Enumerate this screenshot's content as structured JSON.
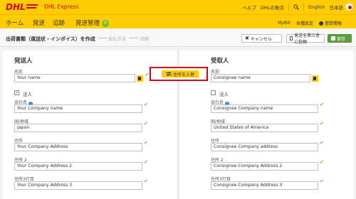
{
  "header": {
    "brand": "DHL Express",
    "links": [
      "ヘルプ",
      "DHLの拠点"
    ],
    "lang_en": "English",
    "lang_ja": "日本語"
  },
  "nav": {
    "items": [
      "ホーム",
      "発送",
      "追跡",
      "発送管理"
    ],
    "badge": "0",
    "right": [
      "MyBill",
      "各種設定"
    ],
    "user": "登録情報"
  },
  "subheader": {
    "step_active": "出荷書類（運送状・インボイス）を作成",
    "steps": [
      "支払方法",
      "印刷"
    ],
    "cancel": "キャンセル",
    "send": "発送を第三者に依頼",
    "save": "保存"
  },
  "swap": {
    "label": "住所を入替"
  },
  "sender": {
    "title": "発送人",
    "name_label": "名前",
    "name_value": "Your name",
    "corporate_label": "法人",
    "company_label": "会社名",
    "company_value": "Your Company name",
    "country_label": "国/地域",
    "country_value": "Japan",
    "address_label": "住所",
    "address_value": "Your Company Address",
    "address2_label": "住所 2",
    "address2_value": "Your Company Address 2",
    "address3_label": "住所3行目",
    "address3_value": "Your Company Address 3"
  },
  "receiver": {
    "title": "受取人",
    "name_label": "名前",
    "name_value": "Consignee name",
    "corporate_label": "法人",
    "company_label": "会社名",
    "company_value": "Consignee Company name",
    "country_label": "国/地域",
    "country_value": "United States of America",
    "address_label": "住所",
    "address_value": "Consignee Company address",
    "address2_label": "住所 2",
    "address2_value": "Consignee Company Address 2",
    "address3_label": "住所3行目",
    "address3_value": "Consignee Company Address 3"
  },
  "colors": {
    "dhl_yellow": "#ffcc00",
    "dhl_red": "#d40511",
    "ok_green": "#76bd22",
    "save_green": "#5aa03c"
  },
  "icons": [
    "dhl-logo",
    "search-icon",
    "japan-flag-icon",
    "user-icon",
    "close-icon",
    "document-icon",
    "save-icon",
    "swap-icon",
    "address-book-icon",
    "checkmark-icon",
    "info-icon"
  ]
}
